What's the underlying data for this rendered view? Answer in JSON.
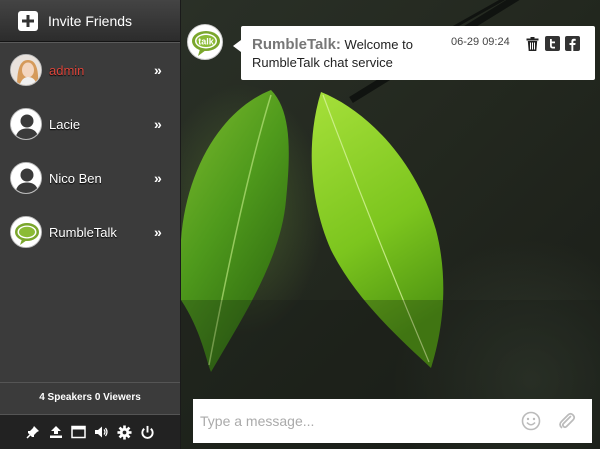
{
  "sidebar": {
    "invite_label": "Invite Friends",
    "users": [
      {
        "name": "admin",
        "is_self": true,
        "avatar": "photo-avatar"
      },
      {
        "name": "Lacie",
        "is_self": false,
        "avatar": "default-user-icon"
      },
      {
        "name": "Nico Ben",
        "is_self": false,
        "avatar": "default-user-icon"
      },
      {
        "name": "RumbleTalk",
        "is_self": false,
        "avatar": "rumbletalk-logo"
      }
    ],
    "stats_text": "4 Speakers 0 Viewers",
    "toolbar_icons": [
      "pin-icon",
      "upload-icon",
      "window-icon",
      "volume-icon",
      "settings-icon",
      "power-icon"
    ]
  },
  "chat": {
    "message": {
      "sender": "RumbleTalk:",
      "text": "Welcome to RumbleTalk chat service",
      "time": "06-29 09:24",
      "logo_text": "talk"
    },
    "input": {
      "placeholder": "Type a message..."
    }
  },
  "colors": {
    "self_name": "#d8443a",
    "sidebar_bg": "#3b3b3b",
    "logo_green": "#7aa62c"
  }
}
